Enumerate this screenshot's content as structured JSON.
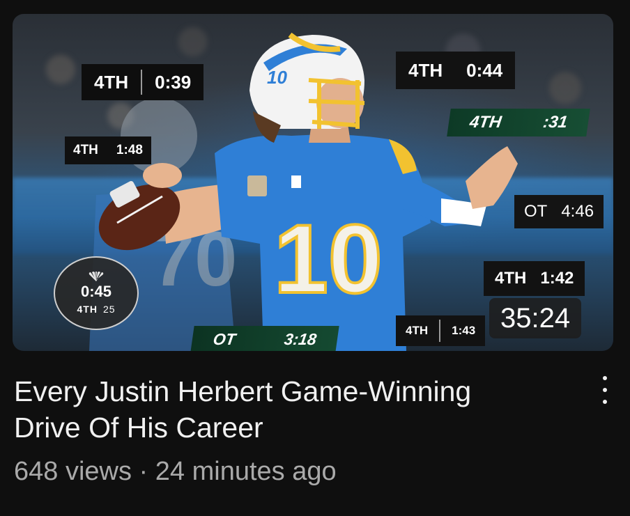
{
  "video": {
    "title": "Every Justin Herbert Game-Winning Drive Of His Career",
    "views": "648 views",
    "separator": "·",
    "uploaded": "24 minutes ago",
    "duration": "35:24"
  },
  "thumbnail": {
    "jersey_number": "10",
    "scoreboards": [
      {
        "quarter": "4TH",
        "clock": "0:39"
      },
      {
        "quarter": "4TH",
        "clock": "0:44"
      },
      {
        "quarter": "4TH",
        "clock": ":31"
      },
      {
        "quarter": "4TH",
        "clock": "1:48"
      },
      {
        "quarter": "OT",
        "clock": "4:46"
      },
      {
        "quarter": "4TH",
        "clock": "1:42"
      },
      {
        "quarter": "4TH",
        "clock": "1:43"
      },
      {
        "quarter": "OT",
        "clock": "3:18"
      }
    ],
    "nbc_bug": {
      "clock": "0:45",
      "quarter": "4TH",
      "play_clock": "25"
    }
  },
  "icons": {
    "more": "more-vertical-icon",
    "network": "nbc-peacock-icon"
  },
  "colors": {
    "background": "#0f0f0f",
    "title": "#f1f1f1",
    "meta": "#aaaaaa",
    "chargers_blue": "#2f7fd6",
    "chargers_gold": "#f2c230"
  }
}
